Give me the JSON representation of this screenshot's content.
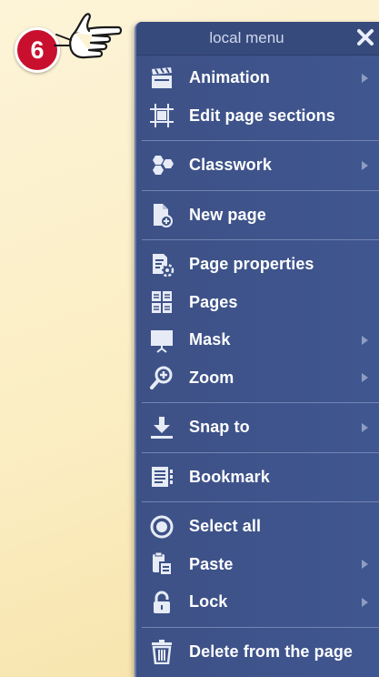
{
  "step_badge": "6",
  "menu": {
    "title": "local menu",
    "items": [
      {
        "label": "Animation",
        "icon": "clapperboard-icon",
        "submenu": true
      },
      {
        "label": "Edit page sections",
        "icon": "crop-frame-icon",
        "submenu": false
      },
      {
        "label": "Classwork",
        "icon": "classwork-hexagons-icon",
        "submenu": true
      },
      {
        "label": "New page",
        "icon": "new-page-icon",
        "submenu": false
      },
      {
        "label": "Page properties",
        "icon": "page-settings-icon",
        "submenu": false
      },
      {
        "label": "Pages",
        "icon": "pages-grid-icon",
        "submenu": false
      },
      {
        "label": "Mask",
        "icon": "mask-screen-icon",
        "submenu": true
      },
      {
        "label": "Zoom",
        "icon": "zoom-in-icon",
        "submenu": true
      },
      {
        "label": "Snap to",
        "icon": "snap-download-icon",
        "submenu": true
      },
      {
        "label": "Bookmark",
        "icon": "bookmark-list-icon",
        "submenu": false
      },
      {
        "label": "Select all",
        "icon": "select-all-radio-icon",
        "submenu": false
      },
      {
        "label": "Paste",
        "icon": "paste-clipboard-icon",
        "submenu": true
      },
      {
        "label": "Lock",
        "icon": "padlock-icon",
        "submenu": true
      },
      {
        "label": "Delete from the page",
        "icon": "trash-icon",
        "submenu": false
      }
    ]
  },
  "colors": {
    "menu_bg": "#3d5186",
    "header_bg": "#374a7c",
    "badge": "#c8102e",
    "background": "#fbeec3"
  }
}
